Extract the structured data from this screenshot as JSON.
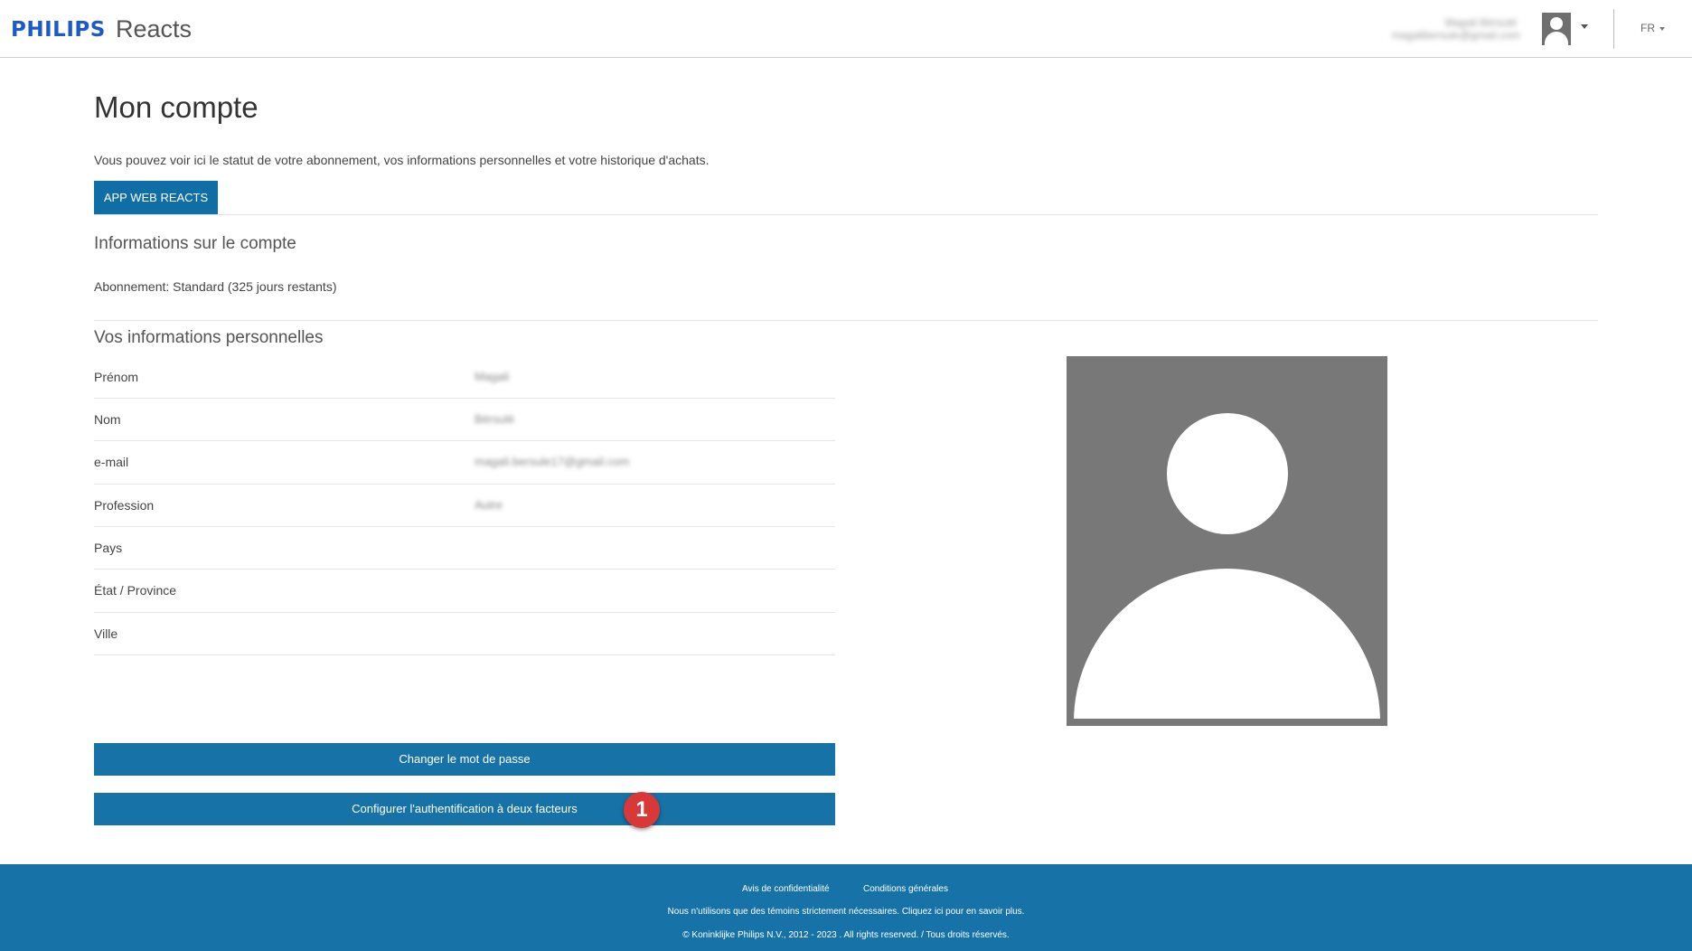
{
  "header": {
    "brand": "PHILIPS",
    "app_name": "Reacts",
    "user_name_line1": "Magali Bérsulé",
    "user_name_line2": "magalibersule@gmail.com",
    "language": "FR"
  },
  "main": {
    "title": "Mon compte",
    "intro": "Vous pouvez voir ici le statut de votre abonnement, vos informations personnelles et votre historique d'achats.",
    "tab_label": "APP WEB REACTS",
    "account_section_title": "Informations sur le compte",
    "subscription_text": "Abonnement: Standard (325 jours restants)",
    "personal_section_title": "Vos informations personnelles",
    "fields": [
      {
        "label": "Prénom",
        "value": "Magali"
      },
      {
        "label": "Nom",
        "value": "Bérsulé"
      },
      {
        "label": "e-mail",
        "value": "magali.bersule17@gmail.com"
      },
      {
        "label": "Profession",
        "value": "Autre"
      },
      {
        "label": "Pays",
        "value": ""
      },
      {
        "label": "État / Province",
        "value": ""
      },
      {
        "label": "Ville",
        "value": ""
      }
    ],
    "change_password_label": "Changer le mot de passe",
    "configure_2fa_label": "Configurer l'authentification à deux facteurs",
    "step_badge": "1"
  },
  "footer": {
    "privacy_link": "Avis de confidentialité",
    "terms_link": "Conditions générales",
    "cookie_note": "Nous n'utilisons que des témoins strictement nécessaires. Cliquez ici pour en savoir plus.",
    "copyright": "© Koninklijke Philips N.V., 2012 - 2023 . All rights reserved. / Tous droits réservés."
  },
  "colors": {
    "primary": "#1672a7",
    "brand_blue": "#1c5bc7",
    "badge_red": "#d93838",
    "avatar_gray": "#787878"
  }
}
